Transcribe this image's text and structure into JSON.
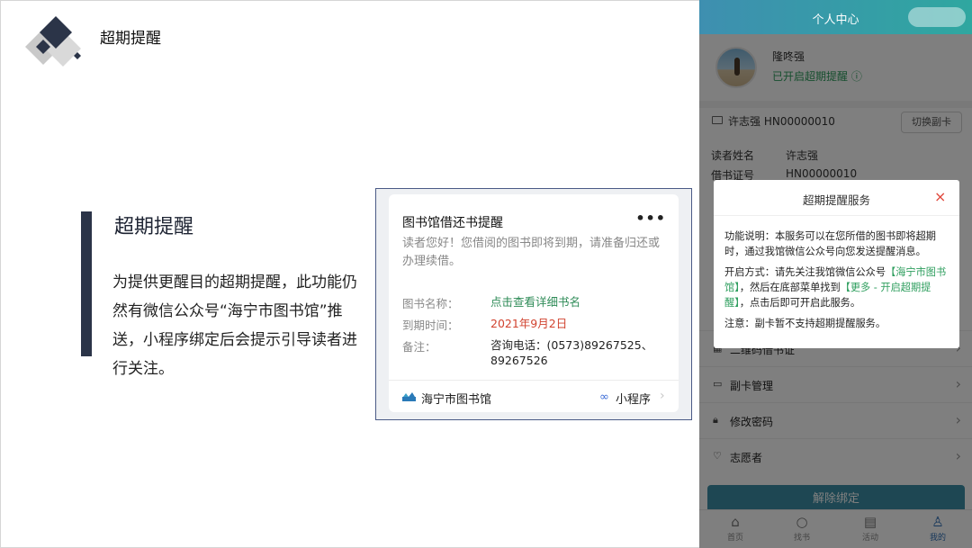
{
  "page": {
    "title": "超期提醒"
  },
  "feature": {
    "heading": "超期提醒",
    "description": "为提供更醒目的超期提醒，此功能仍然有微信公众号“海宁市图书馆”推送，小程序绑定后会提示引导读者进行关注。"
  },
  "notice": {
    "title": "图书馆借还书提醒",
    "more": "•••",
    "greeting": "读者您好！您借阅的图书即将到期，请准备归还或办理续借。",
    "fields": [
      {
        "label": "图书名称：",
        "value": "点击查看详细书名"
      },
      {
        "label": "到期时间：",
        "value": "2021年9月2日"
      },
      {
        "label": "备注：",
        "value": "咨询电话：(0573)89267525、89267526"
      }
    ],
    "source": "海宁市图书馆",
    "mini_program": "小程序",
    "colors": {
      "link_green": "#2e8b57",
      "date_red": "#d1432f"
    }
  },
  "phone": {
    "header_title": "个人中心",
    "profile": {
      "name": "隆咚强",
      "status": "已开启超期提醒 ⓘ"
    },
    "card": {
      "number": "许志强 HN00000010",
      "switch_label": "切换副卡"
    },
    "info": [
      {
        "label": "读者姓名",
        "value": "许志强"
      },
      {
        "label": "借书证号",
        "value": "HN00000010"
      }
    ],
    "menu": [
      {
        "label": "二维码借书证",
        "icon": "qr-icon"
      },
      {
        "label": "副卡管理",
        "icon": "card-icon"
      },
      {
        "label": "修改密码",
        "icon": "lock-icon"
      },
      {
        "label": "志愿者",
        "icon": "heart-icon"
      }
    ],
    "unbind_label": "解除绑定",
    "tabs": [
      {
        "label": "首页",
        "icon": "home-icon"
      },
      {
        "label": "找书",
        "icon": "search-icon"
      },
      {
        "label": "活动",
        "icon": "news-icon"
      },
      {
        "label": "我的",
        "icon": "user-icon"
      }
    ],
    "dialog": {
      "title": "超期提醒服务",
      "close": "×",
      "p1": "功能说明：本服务可以在您所借的图书即将超期时，通过我馆微信公众号向您发送提醒消息。",
      "p2_a": "开启方式：请先关注我馆微信公众号",
      "p2_b": "【海宁市图书馆】",
      "p2_c": "，然后在底部菜单找到",
      "p2_d": "【更多 - 开启超期提醒】",
      "p2_e": "，点击后即可开启此服务。",
      "p3": "注意：副卡暂不支持超期提醒服务。"
    },
    "colors": {
      "header_start": "#3e8fb0",
      "header_end": "#2fa7a0",
      "accent_green": "#2e9e5e",
      "close_red": "#e0473b"
    }
  }
}
